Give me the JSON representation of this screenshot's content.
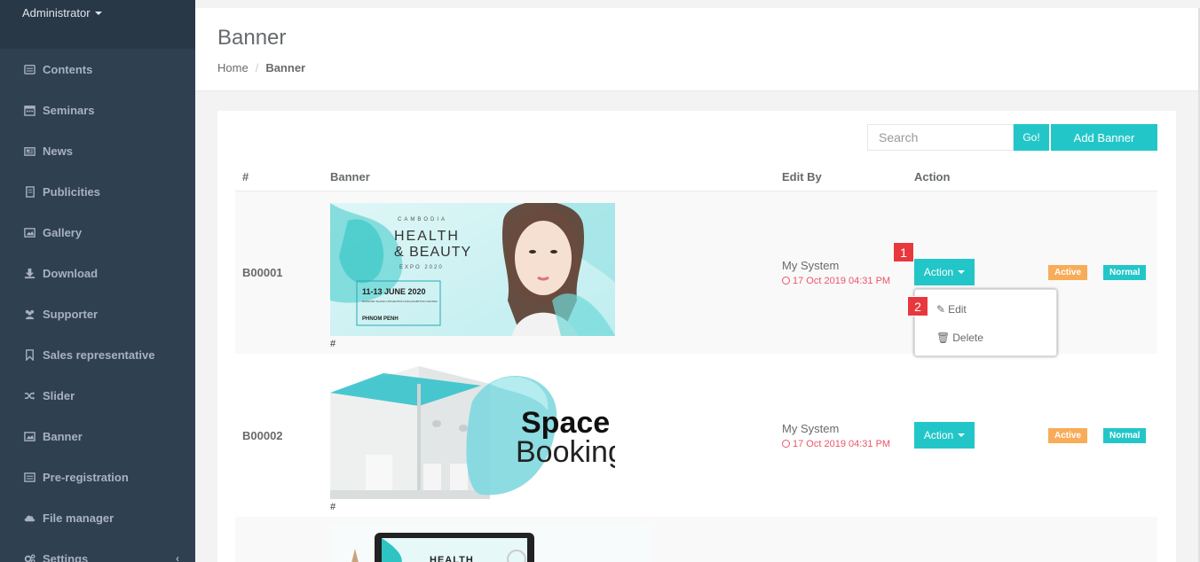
{
  "sidebar": {
    "role": "Administrator",
    "items": [
      {
        "label": "Contents",
        "icon": "list-icon"
      },
      {
        "label": "Seminars",
        "icon": "calendar-icon"
      },
      {
        "label": "News",
        "icon": "newspaper-icon"
      },
      {
        "label": "Publicities",
        "icon": "book-icon"
      },
      {
        "label": "Gallery",
        "icon": "image-icon"
      },
      {
        "label": "Download",
        "icon": "download-icon"
      },
      {
        "label": "Supporter",
        "icon": "users-icon"
      },
      {
        "label": "Sales representative",
        "icon": "bookmark-icon"
      },
      {
        "label": "Slider",
        "icon": "shuffle-icon"
      },
      {
        "label": "Banner",
        "icon": "picture-icon"
      },
      {
        "label": "Pre-registration",
        "icon": "list-alt-icon"
      },
      {
        "label": "File manager",
        "icon": "cloud-icon"
      },
      {
        "label": "Settings",
        "icon": "cogs-icon"
      }
    ]
  },
  "header": {
    "title": "Banner",
    "breadcrumb": {
      "home": "Home",
      "separator": "/",
      "current": "Banner"
    }
  },
  "toolbar": {
    "search_placeholder": "Search",
    "go_label": "Go!",
    "add_label": "Add Banner"
  },
  "table": {
    "columns": [
      "#",
      "Banner",
      "Edit By",
      "Action"
    ],
    "rows": [
      {
        "code": "B00001",
        "hash": "#",
        "editor": "My System",
        "date": "17 Oct 2019 04:31 PM",
        "action": "Action",
        "status": "Active",
        "type": "Normal",
        "image_text": {
          "top": "CAMBODIA",
          "title1": "HEALTH",
          "title2": "& BEAUTY",
          "sub": "EXPO 2020",
          "dates": "11-13 JUNE 2020",
          "venue": "DIAMOND ISLAND CONVENTION AND EXHIBITION CENTER",
          "city": "PHNOM PENH"
        }
      },
      {
        "code": "B00002",
        "hash": "#",
        "editor": "My System",
        "date": "17 Oct 2019 04:31 PM",
        "action": "Action",
        "status": "Active",
        "type": "Normal",
        "image_text": {
          "line1": "Space",
          "line2": "Booking"
        }
      },
      {
        "image_text": {
          "title": "HEALTH"
        }
      }
    ]
  },
  "dropdown": {
    "edit_label": "Edit",
    "delete_label": "Delete"
  },
  "markers": {
    "one": "1",
    "two": "2"
  },
  "colors": {
    "sidebar": "#2f4050",
    "accent": "#23c6c8",
    "warning": "#f8ac59",
    "danger": "#ed5565",
    "marker": "#e8383d"
  }
}
